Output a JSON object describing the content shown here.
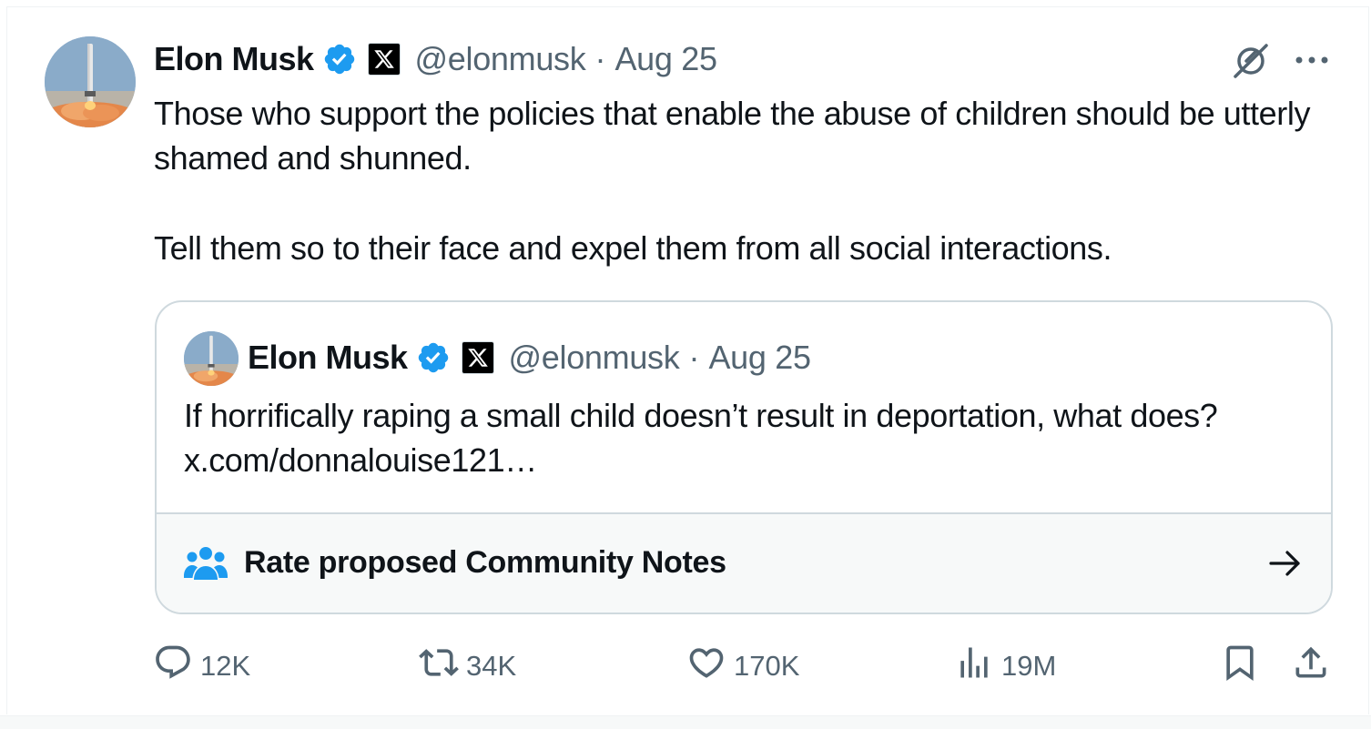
{
  "tweet": {
    "author": {
      "name": "Elon Musk",
      "handle": "@elonmusk",
      "date": "Aug 25",
      "separator": "·"
    },
    "paragraphs": [
      "Those who support the policies that enable the abuse of children should be utterly shamed and shunned.",
      "Tell them so to their face and expel them from all social interactions."
    ],
    "quoted": {
      "author": {
        "name": "Elon Musk",
        "handle": "@elonmusk",
        "date": "Aug 25",
        "separator": "·"
      },
      "text": "If horrifically raping a small child doesn’t result in deportation, what does?",
      "link": "x.com/donnalouise121…",
      "community_notes_label": "Rate proposed Community Notes"
    },
    "stats": {
      "replies": "12K",
      "reposts": "34K",
      "likes": "170K",
      "views": "19M"
    }
  },
  "icons": {
    "verified": "verified-badge-icon",
    "affiliate": "x-logo-icon",
    "grok": "grok-icon",
    "more": "more-dots-icon",
    "notes": "community-notes-icon",
    "arrow": "arrow-right-icon",
    "reply": "reply-icon",
    "repost": "repost-icon",
    "like": "heart-icon",
    "views": "views-icon",
    "bookmark": "bookmark-icon",
    "share": "share-icon"
  },
  "colors": {
    "verified_blue": "#1d9bf0",
    "secondary_text": "#536471",
    "primary_text": "#0f1419",
    "border": "#cfd9de"
  }
}
